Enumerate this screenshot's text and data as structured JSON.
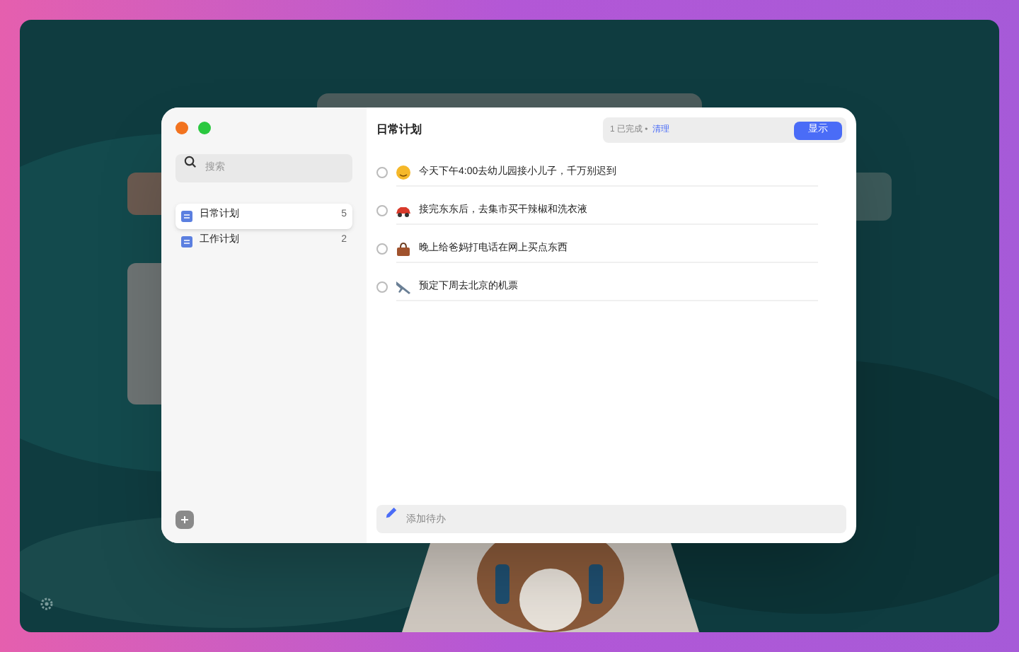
{
  "sidebar": {
    "search": {
      "placeholder": "搜索"
    },
    "lists": [
      {
        "name": "日常计划",
        "count": "5",
        "selected": true
      },
      {
        "name": "工作计划",
        "count": "2",
        "selected": false
      }
    ]
  },
  "main": {
    "title": "日常计划",
    "completed_summary": "1 已完成 •",
    "clear_link": "清理",
    "show_button": "显示",
    "todos": [
      {
        "text": "今天下午4:00去幼儿园接小儿子，千万别迟到",
        "checked": false
      },
      {
        "text": "接完东东后，去集市买干辣椒和洗衣液",
        "checked": false
      },
      {
        "text": "晚上给爸妈打电话在网上买点东西",
        "checked": false
      },
      {
        "text": "预定下周去北京的机票",
        "checked": false
      }
    ],
    "add_field": {
      "placeholder": "添加待办"
    }
  }
}
